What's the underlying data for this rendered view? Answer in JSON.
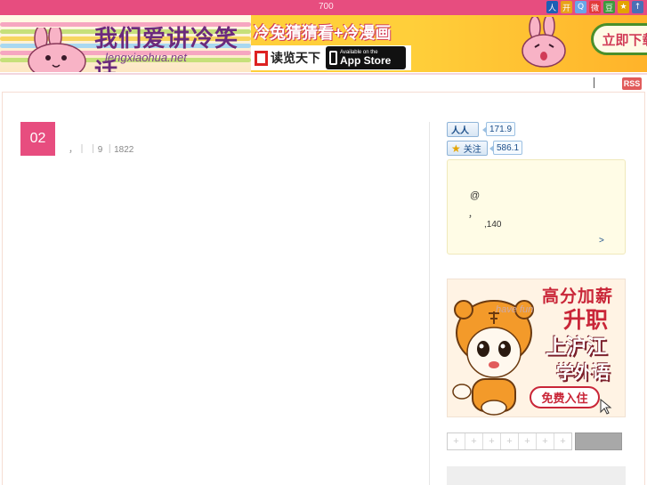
{
  "topbar": {
    "count": "700",
    "icons": [
      {
        "name": "renren-icon",
        "symbol": "人",
        "color": "#1d5fb5"
      },
      {
        "name": "kaixin-icon",
        "symbol": "开",
        "color": "#e9a21a"
      },
      {
        "name": "qzone-icon",
        "symbol": "Q",
        "color": "#6aa6e8"
      },
      {
        "name": "weibo-icon",
        "symbol": "微",
        "color": "#e23a3a"
      },
      {
        "name": "douban-icon",
        "symbol": "豆",
        "color": "#3f9a3f"
      },
      {
        "name": "favorite-icon",
        "symbol": "★",
        "color": "#e4a400"
      },
      {
        "name": "share-icon",
        "symbol": "↑",
        "color": "#4a6fb5"
      }
    ]
  },
  "banner": {
    "title": "我们爱讲冷笑话。",
    "url": "lengxiaohua.net",
    "slogan": "冷兔猜猜看+冷漫画",
    "reader": "读览天下",
    "appstore_small": "Available on the",
    "appstore_big": "App Store",
    "download": "立即下载!"
  },
  "nav": {
    "rss": "RSS"
  },
  "post": {
    "day": "02",
    "meta": "，｜ ｜9 ｜1822"
  },
  "sidebar": {
    "renren": {
      "icon": "人人",
      "count": "171.9"
    },
    "star": {
      "label": "关注",
      "count": "586.1"
    },
    "note": {
      "line1": "@",
      "line2": "，",
      "line3": ",140",
      "more": ">"
    }
  },
  "ad": {
    "line1": "高分加薪",
    "line2": "升职",
    "line3": "上沪江",
    "line4": "学外语",
    "cta": "免费入住",
    "fun": "have fun"
  },
  "calendar": {
    "cells": [
      "+",
      "+",
      "+",
      "+",
      "+",
      "+",
      "+"
    ]
  }
}
